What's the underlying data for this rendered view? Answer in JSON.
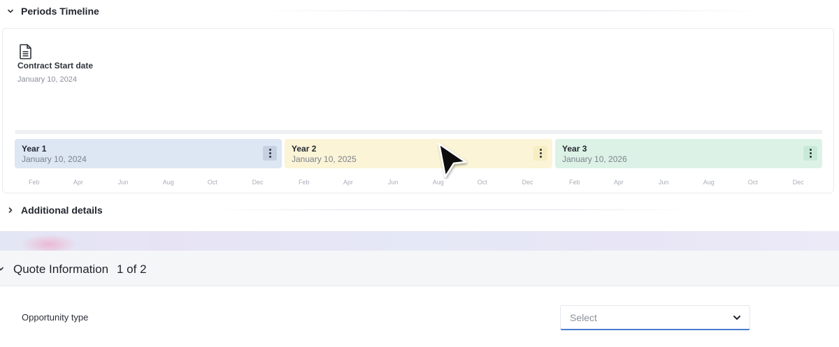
{
  "periods_timeline": {
    "title": "Periods Timeline",
    "contract": {
      "icon": "document-icon",
      "label": "Contract Start date",
      "date": "January 10, 2024"
    },
    "periods": [
      {
        "name": "Year 1",
        "date": "January 10, 2024",
        "color": "#dde6f3",
        "menu_color": "#c5d0e0"
      },
      {
        "name": "Year 2",
        "date": "January 10, 2025",
        "color": "#fbf4d6",
        "menu_color": "#f7edc2"
      },
      {
        "name": "Year 3",
        "date": "January 10, 2026",
        "color": "#ddf2e6",
        "menu_color": "#c7ead6"
      }
    ],
    "months": [
      "Feb",
      "Apr",
      "Jun",
      "Aug",
      "Oct",
      "Dec",
      "Feb",
      "Apr",
      "Jun",
      "Aug",
      "Oct",
      "Dec",
      "Feb",
      "Apr",
      "Jun",
      "Aug",
      "Oct",
      "Dec"
    ]
  },
  "additional_details": {
    "title": "Additional details"
  },
  "quote_information": {
    "title": "Quote Information",
    "count": "1 of 2"
  },
  "opportunity_type": {
    "label": "Opportunity type",
    "placeholder": "Select"
  },
  "colors": {
    "accent": "#4a7bd1",
    "cursor": "#000000"
  }
}
